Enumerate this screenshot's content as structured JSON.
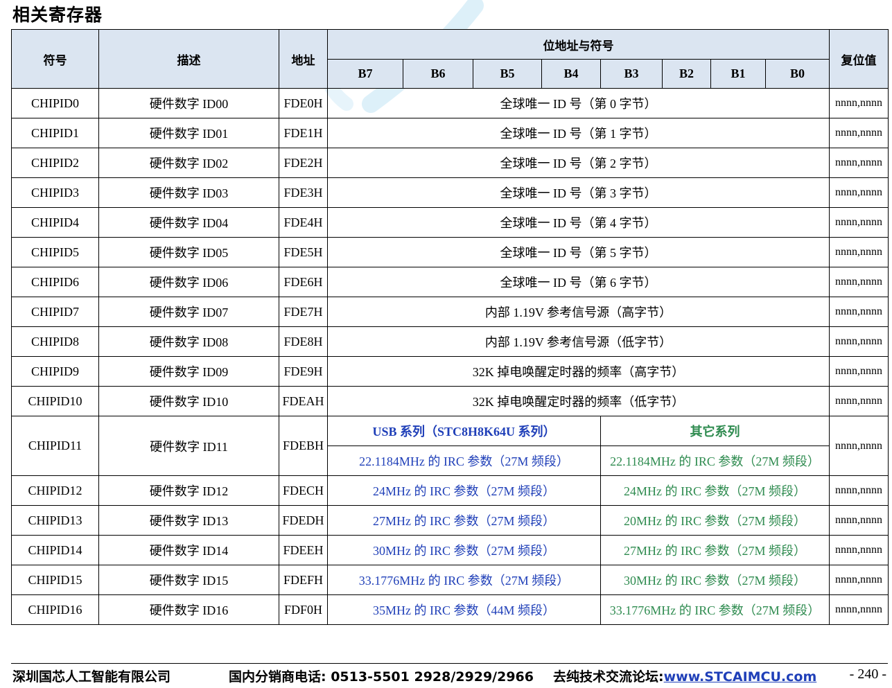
{
  "title": "相关寄存器",
  "colors": {
    "header_bg": "#dbe5f1",
    "usb_series": "#1f3fb8",
    "other_series": "#2e8b4f",
    "watermark": "#9fd3ef"
  },
  "watermark": {
    "icon": "watermark-logo"
  },
  "headers": {
    "symbol": "符号",
    "description": "描述",
    "address": "地址",
    "bit_address": "位地址与符号",
    "bits": [
      "B7",
      "B6",
      "B5",
      "B4",
      "B3",
      "B2",
      "B1",
      "B0"
    ],
    "reset": "复位值"
  },
  "rows": [
    {
      "symbol": "CHIPID0",
      "desc": "硬件数字 ID00",
      "addr": "FDE0H",
      "content": "全球唯一 ID 号（第 0 字节）",
      "reset": "nnnn,nnnn"
    },
    {
      "symbol": "CHIPID1",
      "desc": "硬件数字 ID01",
      "addr": "FDE1H",
      "content": "全球唯一 ID 号（第 1 字节）",
      "reset": "nnnn,nnnn"
    },
    {
      "symbol": "CHIPID2",
      "desc": "硬件数字 ID02",
      "addr": "FDE2H",
      "content": "全球唯一 ID 号（第 2 字节）",
      "reset": "nnnn,nnnn"
    },
    {
      "symbol": "CHIPID3",
      "desc": "硬件数字 ID03",
      "addr": "FDE3H",
      "content": "全球唯一 ID 号（第 3 字节）",
      "reset": "nnnn,nnnn"
    },
    {
      "symbol": "CHIPID4",
      "desc": "硬件数字 ID04",
      "addr": "FDE4H",
      "content": "全球唯一 ID 号（第 4 字节）",
      "reset": "nnnn,nnnn"
    },
    {
      "symbol": "CHIPID5",
      "desc": "硬件数字 ID05",
      "addr": "FDE5H",
      "content": "全球唯一 ID 号（第 5 字节）",
      "reset": "nnnn,nnnn"
    },
    {
      "symbol": "CHIPID6",
      "desc": "硬件数字 ID06",
      "addr": "FDE6H",
      "content": "全球唯一 ID 号（第 6 字节）",
      "reset": "nnnn,nnnn"
    },
    {
      "symbol": "CHIPID7",
      "desc": "硬件数字 ID07",
      "addr": "FDE7H",
      "content": "内部 1.19V 参考信号源（高字节）",
      "reset": "nnnn,nnnn"
    },
    {
      "symbol": "CHIPID8",
      "desc": "硬件数字 ID08",
      "addr": "FDE8H",
      "content": "内部 1.19V 参考信号源（低字节）",
      "reset": "nnnn,nnnn"
    },
    {
      "symbol": "CHIPID9",
      "desc": "硬件数字 ID09",
      "addr": "FDE9H",
      "content": "32K 掉电唤醒定时器的频率（高字节）",
      "reset": "nnnn,nnnn"
    },
    {
      "symbol": "CHIPID10",
      "desc": "硬件数字 ID10",
      "addr": "FDEAH",
      "content": "32K 掉电唤醒定时器的频率（低字节）",
      "reset": "nnnn,nnnn"
    }
  ],
  "split": {
    "usb_header": "USB 系列（STC8H8K64U 系列）",
    "other_header": "其它系列",
    "rows": [
      {
        "symbol": "CHIPID11",
        "desc": "硬件数字 ID11",
        "addr": "FDEBH",
        "usb": "22.1184MHz 的 IRC 参数（27M 频段）",
        "other": "22.1184MHz 的 IRC 参数（27M 频段）",
        "reset": "nnnn,nnnn"
      },
      {
        "symbol": "CHIPID12",
        "desc": "硬件数字 ID12",
        "addr": "FDECH",
        "usb": "24MHz 的 IRC 参数（27M 频段）",
        "other": "24MHz 的 IRC 参数（27M 频段）",
        "reset": "nnnn,nnnn"
      },
      {
        "symbol": "CHIPID13",
        "desc": "硬件数字 ID13",
        "addr": "FDEDH",
        "usb": "27MHz 的 IRC 参数（27M 频段）",
        "other": "20MHz 的 IRC 参数（27M 频段）",
        "reset": "nnnn,nnnn"
      },
      {
        "symbol": "CHIPID14",
        "desc": "硬件数字 ID14",
        "addr": "FDEEH",
        "usb": "30MHz 的 IRC 参数（27M 频段）",
        "other": "27MHz 的 IRC 参数（27M 频段）",
        "reset": "nnnn,nnnn"
      },
      {
        "symbol": "CHIPID15",
        "desc": "硬件数字 ID15",
        "addr": "FDEFH",
        "usb": "33.1776MHz 的 IRC 参数（27M 频段）",
        "other": "30MHz 的 IRC 参数（27M 频段）",
        "reset": "nnnn,nnnn"
      },
      {
        "symbol": "CHIPID16",
        "desc": "硬件数字 ID16",
        "addr": "FDF0H",
        "usb": "35MHz 的 IRC 参数（44M 频段）",
        "other": "33.1776MHz 的 IRC 参数（27M 频段）",
        "reset": "nnnn,nnnn"
      }
    ]
  },
  "footer": {
    "company": "深圳国芯人工智能有限公司",
    "phone": "国内分销商电话: 0513-5501 2928/2929/2966",
    "forum_label": "去纯技术交流论坛:",
    "forum_link": "www.STCAIMCU.com",
    "page": "- 240 -"
  }
}
